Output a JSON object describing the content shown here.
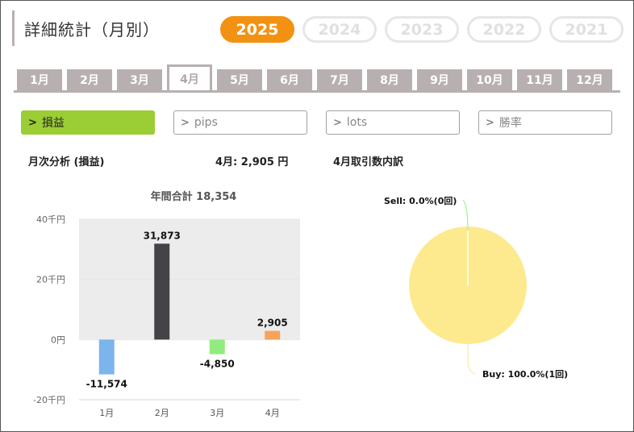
{
  "header": {
    "title": "詳細統計（月別）"
  },
  "years": [
    {
      "label": "2025",
      "active": true
    },
    {
      "label": "2024",
      "active": false
    },
    {
      "label": "2023",
      "active": false
    },
    {
      "label": "2022",
      "active": false
    },
    {
      "label": "2021",
      "active": false
    }
  ],
  "months": [
    "1月",
    "2月",
    "3月",
    "4月",
    "5月",
    "6月",
    "7月",
    "8月",
    "9月",
    "10月",
    "11月",
    "12月"
  ],
  "active_month_index": 3,
  "filters": [
    {
      "label": "損益",
      "active": true
    },
    {
      "label": "pips",
      "active": false
    },
    {
      "label": "lots",
      "active": false
    },
    {
      "label": "勝率",
      "active": false
    }
  ],
  "sections": {
    "left_title": "月次分析 (損益)",
    "month_summary": "4月:  2,905 円",
    "right_title": "4月取引数内訳"
  },
  "chart_data": [
    {
      "type": "bar",
      "title": "年間合計 18,354",
      "categories": [
        "1月",
        "2月",
        "3月",
        "4月"
      ],
      "values": [
        -11574,
        31873,
        -4850,
        2905
      ],
      "value_labels": [
        "-11,574",
        "31,873",
        "-4,850",
        "2,905"
      ],
      "bar_colors": [
        "#7cb4ec",
        "#434348",
        "#90ed7d",
        "#f7a35c"
      ],
      "ylim": [
        -20000,
        40000
      ],
      "yticks": [
        {
          "value": 40000,
          "label": "40千円"
        },
        {
          "value": 20000,
          "label": "20千円"
        },
        {
          "value": 0,
          "label": "0円"
        },
        {
          "value": -20000,
          "label": "-20千円"
        }
      ],
      "band_color": "#ececec",
      "grid": true
    },
    {
      "type": "pie",
      "title": "",
      "slices": [
        {
          "name": "Sell",
          "label": "Sell: 0.0%(0回)",
          "value": 0,
          "color": "#90ed7d"
        },
        {
          "name": "Buy",
          "label": "Buy: 100.0%(1回)",
          "value": 1,
          "color": "#fdea8f"
        }
      ]
    }
  ]
}
